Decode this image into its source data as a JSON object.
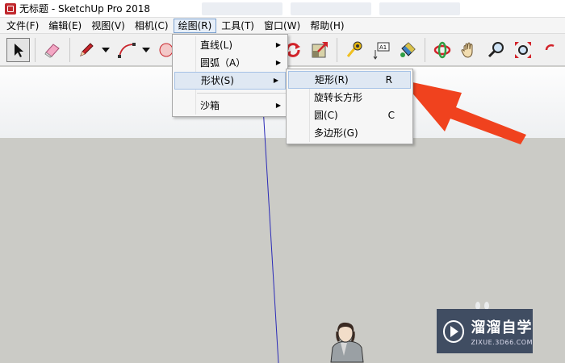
{
  "window": {
    "title": "无标题 - SketchUp Pro 2018"
  },
  "menubar": {
    "items": [
      "文件(F)",
      "编辑(E)",
      "视图(V)",
      "相机(C)",
      "绘图(R)",
      "工具(T)",
      "窗口(W)",
      "帮助(H)"
    ],
    "active_index": 4
  },
  "toolbar": {
    "tools": [
      "select-icon",
      "eraser-icon",
      "pencil-icon",
      "arc-icon",
      "circle-icon",
      "rotate-icon",
      "scale-icon",
      "tape-measure-icon",
      "text-icon",
      "paint-bucket-icon",
      "orbit-icon",
      "pan-icon",
      "zoom-icon",
      "zoom-extents-icon"
    ]
  },
  "draw_menu": {
    "items": [
      {
        "label": "直线(L)",
        "submenu": true
      },
      {
        "label": "圆弧（A）",
        "submenu": true
      },
      {
        "label": "形状(S)",
        "submenu": true,
        "highlighted": true
      },
      {
        "label": "沙箱",
        "submenu": true
      }
    ]
  },
  "shape_submenu": {
    "items": [
      {
        "label": "矩形(R)",
        "shortcut": "R",
        "highlighted": true
      },
      {
        "label": "旋转长方形",
        "shortcut": ""
      },
      {
        "label": "圆(C)",
        "shortcut": "C"
      },
      {
        "label": "多边形(G)",
        "shortcut": ""
      }
    ]
  },
  "watermark": {
    "main": "溜溜自学",
    "sub": "ZIXUE.3D66.COM"
  },
  "colors": {
    "arrow": "#f0421e",
    "axis": "#2b2bb8",
    "menu_highlight": "#dfe8f3"
  }
}
